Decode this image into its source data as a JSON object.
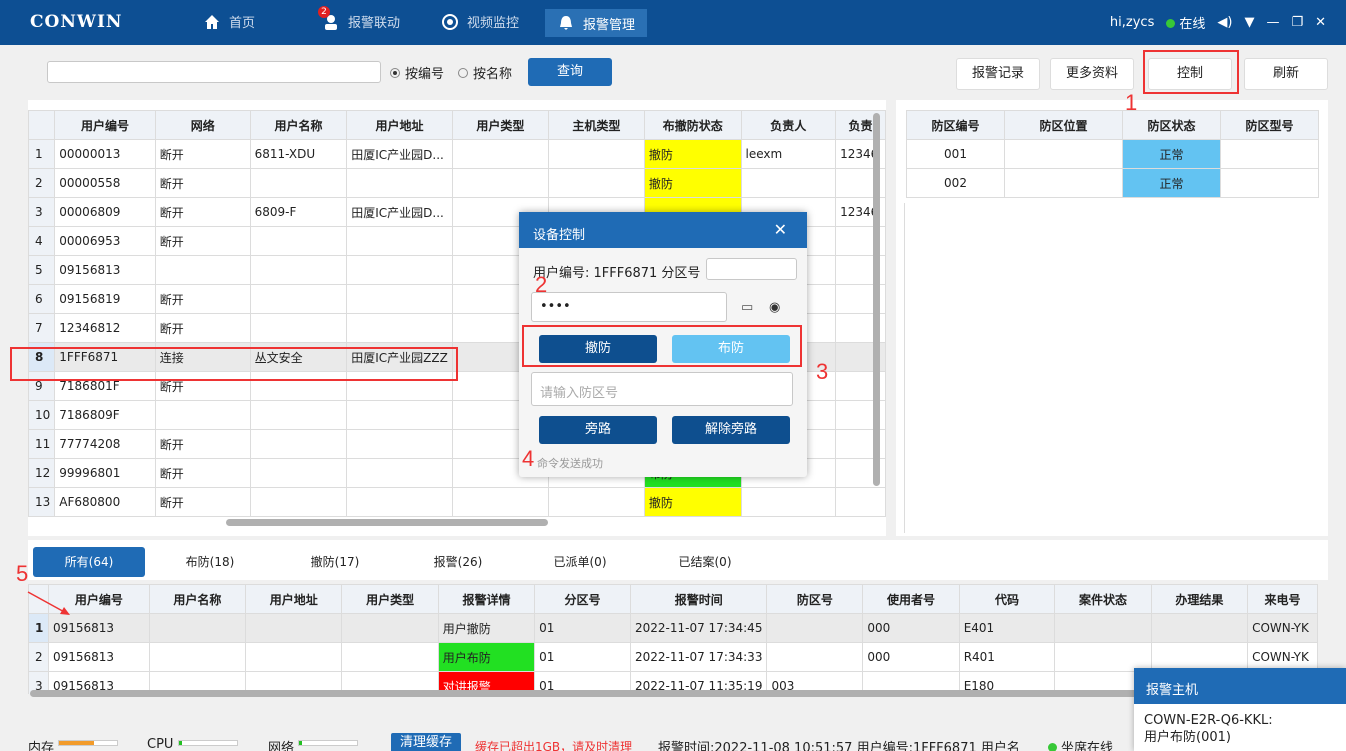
{
  "app": {
    "logo": "CONWIN",
    "user": "hi,zycs",
    "online": "在线"
  },
  "nav": [
    {
      "label": "首页",
      "icon": "home-icon"
    },
    {
      "label": "报警联动",
      "icon": "user-icon",
      "badge": "2"
    },
    {
      "label": "视频监控",
      "icon": "camera-icon"
    },
    {
      "label": "报警管理",
      "icon": "bell-icon"
    }
  ],
  "search": {
    "opt1": "按编号",
    "opt2": "按名称",
    "query": "查询"
  },
  "actions": {
    "record": "报警记录",
    "more": "更多资料",
    "control": "控制",
    "refresh": "刷新"
  },
  "users": {
    "headers": [
      "用户编号",
      "网络",
      "用户名称",
      "用户地址",
      "用户类型",
      "主机类型",
      "布撤防状态",
      "负责人",
      "负责"
    ],
    "rows": [
      [
        "1",
        "00000013",
        "断开",
        "6811-XDU",
        "田厦IC产业园D...",
        "",
        "",
        "撤防",
        "leexm",
        "12346"
      ],
      [
        "2",
        "00000558",
        "断开",
        "",
        "",
        "",
        "",
        "撤防",
        "",
        ""
      ],
      [
        "3",
        "00006809",
        "断开",
        "6809-F",
        "田厦IC产业园D...",
        "",
        "",
        "",
        "",
        "12346"
      ],
      [
        "4",
        "00006953",
        "断开",
        "",
        "",
        "",
        "",
        "",
        "",
        ""
      ],
      [
        "5",
        "09156813",
        "",
        "",
        "",
        "",
        "",
        "",
        "",
        ""
      ],
      [
        "6",
        "09156819",
        "断开",
        "",
        "",
        "",
        "",
        "",
        "",
        ""
      ],
      [
        "7",
        "12346812",
        "断开",
        "",
        "",
        "",
        "",
        "",
        "",
        ""
      ],
      [
        "8",
        "1FFF6871",
        "连接",
        "丛文安全",
        "田厦IC产业园ZZZ",
        "",
        "",
        "",
        "",
        ""
      ],
      [
        "9",
        "7186801F",
        "断开",
        "",
        "",
        "",
        "",
        "",
        "",
        ""
      ],
      [
        "10",
        "7186809F",
        "",
        "",
        "",
        "",
        "",
        "",
        "",
        ""
      ],
      [
        "11",
        "77774208",
        "断开",
        "",
        "",
        "",
        "",
        "",
        "",
        ""
      ],
      [
        "12",
        "99996801",
        "断开",
        "",
        "",
        "",
        "",
        "布防",
        "",
        ""
      ],
      [
        "13",
        "AF680800",
        "断开",
        "",
        "",
        "",
        "",
        "撤防",
        "",
        ""
      ]
    ]
  },
  "zones": {
    "headers": [
      "防区编号",
      "防区位置",
      "防区状态",
      "防区型号"
    ],
    "rows": [
      [
        "001",
        "",
        "正常",
        ""
      ],
      [
        "002",
        "",
        "正常",
        ""
      ]
    ]
  },
  "dialog": {
    "title": "设备控制",
    "user_label": "用户编号: 1FFF6871 分区号",
    "password": "••••",
    "disarm": "撤防",
    "arm": "布防",
    "zone_placeholder": "请输入防区号",
    "bypass": "旁路",
    "unbypass": "解除旁路",
    "msg": "命令发送成功"
  },
  "bottom_tabs": [
    "所有(64)",
    "布防(18)",
    "撤防(17)",
    "报警(26)",
    "已派单(0)",
    "已结案(0)"
  ],
  "alarms": {
    "headers": [
      "用户编号",
      "用户名称",
      "用户地址",
      "用户类型",
      "报警详情",
      "分区号",
      "报警时间",
      "防区号",
      "使用者号",
      "代码",
      "案件状态",
      "办理结果",
      "来电号"
    ],
    "rows": [
      [
        "1",
        "09156813",
        "",
        "",
        "",
        "用户撤防",
        "01",
        "2022-11-07 17:34:45",
        "",
        "000",
        "E401",
        "",
        "",
        "COWN-YK"
      ],
      [
        "2",
        "09156813",
        "",
        "",
        "",
        "用户布防",
        "01",
        "2022-11-07 17:34:33",
        "",
        "000",
        "R401",
        "",
        "",
        "COWN-YK"
      ],
      [
        "3",
        "09156813",
        "",
        "",
        "",
        "对讲报警",
        "01",
        "2022-11-07 11:35:19",
        "003",
        "",
        "E180",
        "",
        "",
        ""
      ]
    ]
  },
  "annotations": [
    "1",
    "2",
    "3",
    "4",
    "5"
  ],
  "status": {
    "mem": "内存",
    "cpu": "CPU",
    "net": "网络",
    "clear": "清理缓存",
    "warn": "缓存已超出1GB，请及时清理",
    "info": "报警时间:2022-11-08 10:51:57 用户编号:1FFF6871 用户名",
    "seat": "坐席在线"
  },
  "popup": {
    "title": "报警主机",
    "line1": "COWN-E2R-Q6-KKL:",
    "line2": "用户布防(001)"
  }
}
